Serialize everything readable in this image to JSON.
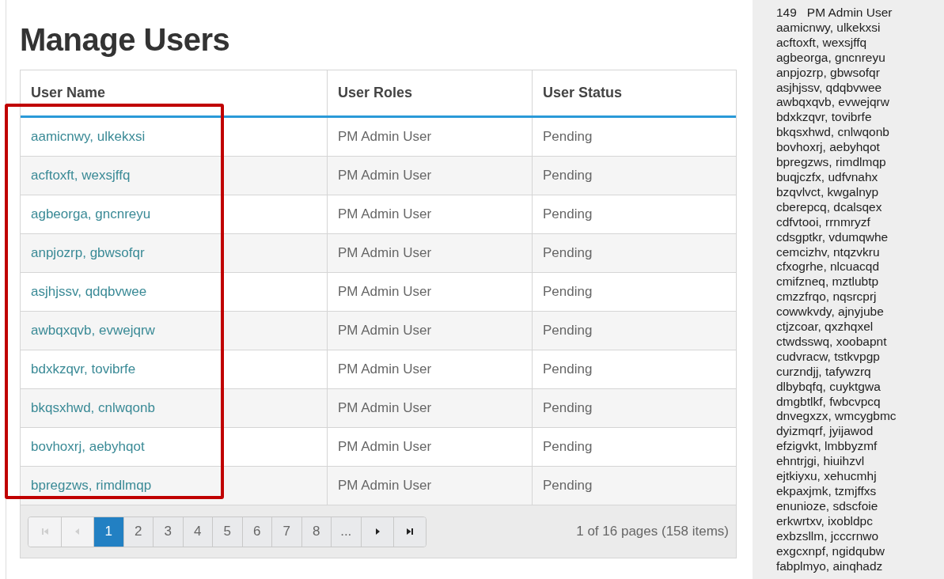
{
  "title": "Manage Users",
  "table": {
    "columns": [
      "User Name",
      "User Roles",
      "User Status"
    ],
    "rows": [
      {
        "name": "aamicnwy, ulkekxsi",
        "role": "PM Admin User",
        "status": "Pending"
      },
      {
        "name": "acftoxft, wexsjffq",
        "role": "PM Admin User",
        "status": "Pending"
      },
      {
        "name": "agbeorga, gncnreyu",
        "role": "PM Admin User",
        "status": "Pending"
      },
      {
        "name": "anpjozrp, gbwsofqr",
        "role": "PM Admin User",
        "status": "Pending"
      },
      {
        "name": "asjhjssv, qdqbvwee",
        "role": "PM Admin User",
        "status": "Pending"
      },
      {
        "name": "awbqxqvb, evwejqrw",
        "role": "PM Admin User",
        "status": "Pending"
      },
      {
        "name": "bdxkzqvr, tovibrfe",
        "role": "PM Admin User",
        "status": "Pending"
      },
      {
        "name": "bkqsxhwd, cnlwqonb",
        "role": "PM Admin User",
        "status": "Pending"
      },
      {
        "name": "bovhoxrj, aebyhqot",
        "role": "PM Admin User",
        "status": "Pending"
      },
      {
        "name": "bpregzws, rimdlmqp",
        "role": "PM Admin User",
        "status": "Pending"
      }
    ]
  },
  "pager": {
    "buttons": [
      {
        "kind": "first",
        "disabled": true
      },
      {
        "kind": "prev",
        "disabled": true
      },
      {
        "kind": "page",
        "label": "1",
        "selected": true
      },
      {
        "kind": "page",
        "label": "2",
        "selected": false
      },
      {
        "kind": "page",
        "label": "3",
        "selected": false
      },
      {
        "kind": "page",
        "label": "4",
        "selected": false
      },
      {
        "kind": "page",
        "label": "5",
        "selected": false
      },
      {
        "kind": "page",
        "label": "6",
        "selected": false
      },
      {
        "kind": "page",
        "label": "7",
        "selected": false
      },
      {
        "kind": "page",
        "label": "8",
        "selected": false
      },
      {
        "kind": "page",
        "label": "...",
        "selected": false
      },
      {
        "kind": "next",
        "disabled": false
      },
      {
        "kind": "last",
        "disabled": false
      }
    ],
    "info": "1 of 16 pages (158 items)"
  },
  "highlight": {
    "color": "#c00000"
  },
  "side_panel": {
    "count": "149",
    "role": "PM Admin User",
    "names": [
      "aamicnwy, ulkekxsi",
      "acftoxft, wexsjffq",
      "agbeorga, gncnreyu",
      "anpjozrp, gbwsofqr",
      "asjhjssv, qdqbvwee",
      "awbqxqvb, evwejqrw",
      "bdxkzqvr, tovibrfe",
      "bkqsxhwd, cnlwqonb",
      "bovhoxrj, aebyhqot",
      "bpregzws, rimdlmqp",
      "buqjczfx, udfvnahx",
      "bzqvlvct, kwgalnyp",
      "cberepcq, dcalsqex",
      "cdfvtooi, rrnmryzf",
      "cdsgptkr, vdumqwhe",
      "cemcizhv, ntqzvkru",
      "cfxogrhe, nlcuacqd",
      "cmifzneq, mztlubtp",
      "cmzzfrqo, nqsrcprj",
      "cowwkvdy, ajnyjube",
      "ctjzcoar, qxzhqxel",
      "ctwdsswq, xoobapnt",
      "cudvracw, tstkvpgp",
      "curzndjj, tafywzrq",
      "dlbybqfq, cuyktgwa",
      "dmgbtlkf, fwbcvpcq",
      "dnvegxzx, wmcygbmc",
      "dyizmqrf, jyijawod",
      "efzigvkt, lmbbyzmf",
      "ehntrjgi, hiuihzvl",
      "ejtkiyxu, xehucmhj",
      "ekpaxjmk, tzmjffxs",
      "enunioze, sdscfoie",
      "erkwrtxv, ixobldpc",
      "exbzsllm, jcccrnwo",
      "exgcxnpf, ngidqubw",
      "fabplmyo, ainqhadz"
    ]
  }
}
